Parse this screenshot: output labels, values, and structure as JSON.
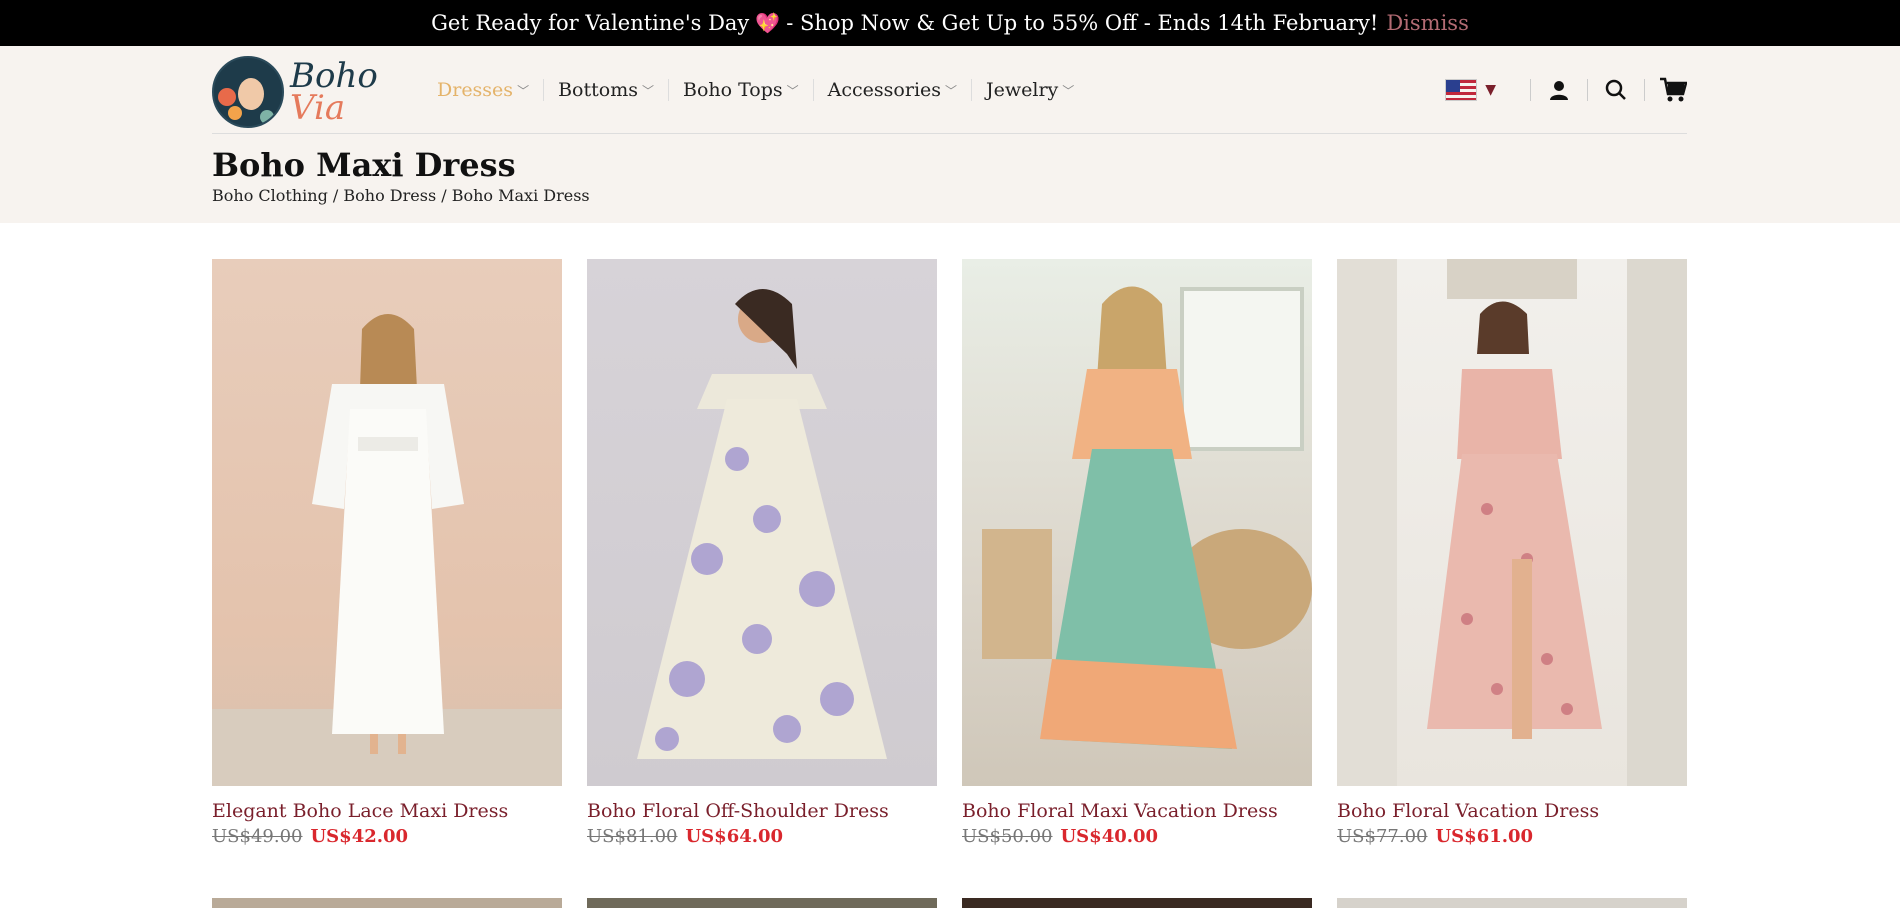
{
  "announcement": {
    "text_before": "Get Ready for Valentine's Day",
    "heart": "💖",
    "text_after": "- Shop Now & Get Up to 55% Off - Ends 14th February!",
    "dismiss": "Dismiss"
  },
  "logo": {
    "line1": "Boho",
    "line2": "Via"
  },
  "nav": [
    {
      "label": "Dresses",
      "active": true
    },
    {
      "label": "Bottoms"
    },
    {
      "label": "Boho Tops"
    },
    {
      "label": "Accessories"
    },
    {
      "label": "Jewelry"
    }
  ],
  "header_icons": [
    "us-flag-icon",
    "account-icon",
    "search-icon",
    "cart-icon"
  ],
  "page": {
    "title": "Boho Maxi Dress",
    "breadcrumb": "Boho Clothing / Boho Dress / Boho Maxi Dress"
  },
  "products": [
    {
      "name": "Elegant Boho Lace Maxi Dress",
      "old_price": "US$49.00",
      "price": "US$42.00"
    },
    {
      "name": "Boho Floral Off-Shoulder Dress",
      "old_price": "US$81.00",
      "price": "US$64.00"
    },
    {
      "name": "Boho Floral Maxi Vacation Dress",
      "old_price": "US$50.00",
      "price": "US$40.00"
    },
    {
      "name": "Boho Floral Vacation Dress",
      "old_price": "US$77.00",
      "price": "US$61.00"
    }
  ],
  "colors": {
    "accent_nav": "#e4b36a",
    "product_name": "#7a1f2b",
    "sale_price": "#d9272d"
  }
}
